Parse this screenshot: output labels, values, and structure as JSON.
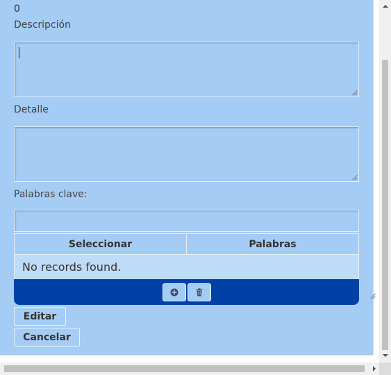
{
  "form": {
    "count": "0",
    "descripcion_label": "Descripción",
    "detalle_label": "Detalle",
    "palabras_label": "Palabras clave:",
    "descripcion_value": "",
    "detalle_value": "",
    "palabras_value": ""
  },
  "table": {
    "columns": [
      "Seleccionar",
      "Palabras"
    ],
    "empty_message": "No records found.",
    "toolbar": {
      "add_icon": "plus-circle-icon",
      "delete_icon": "trash-icon"
    }
  },
  "buttons": {
    "editar": "Editar",
    "cancelar": "Cancelar"
  },
  "colors": {
    "panel_bg": "#a5ccf4",
    "toolbar_bg": "#0041a8",
    "row_bg": "#bedbf8"
  }
}
